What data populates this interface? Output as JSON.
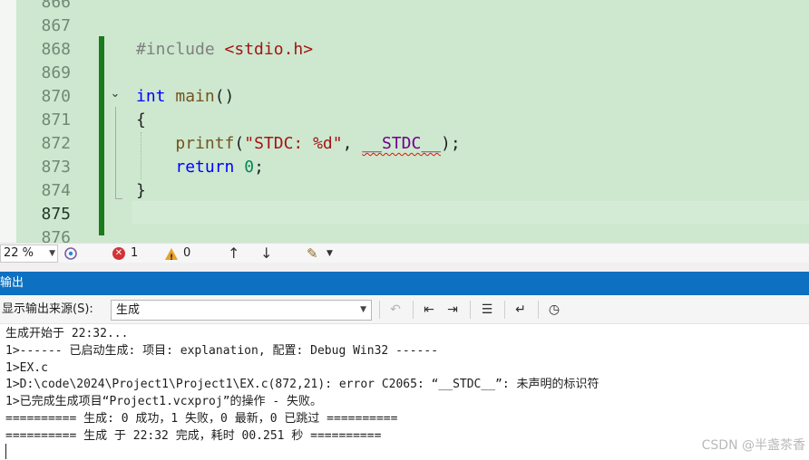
{
  "editor": {
    "lines": [
      {
        "num": "866",
        "tokens": []
      },
      {
        "num": "867",
        "tokens": []
      },
      {
        "num": "868",
        "tokens": [
          {
            "t": "#include ",
            "c": "pre"
          },
          {
            "t": "<stdio.h>",
            "c": "inc"
          }
        ]
      },
      {
        "num": "869",
        "tokens": []
      },
      {
        "num": "870",
        "tokens": [
          {
            "t": "int",
            "c": "kw"
          },
          {
            "t": " ",
            "c": "punc"
          },
          {
            "t": "main",
            "c": "fn"
          },
          {
            "t": "()",
            "c": "punc"
          }
        ]
      },
      {
        "num": "871",
        "tokens": [
          {
            "t": "{",
            "c": "punc"
          }
        ]
      },
      {
        "num": "872",
        "tokens": [
          {
            "t": "    ",
            "c": "punc"
          },
          {
            "t": "printf",
            "c": "fn"
          },
          {
            "t": "(",
            "c": "punc"
          },
          {
            "t": "\"STDC: %d\"",
            "c": "str"
          },
          {
            "t": ", ",
            "c": "punc"
          },
          {
            "t": "__STDC__",
            "c": "mac"
          },
          {
            "t": ");",
            "c": "punc"
          }
        ]
      },
      {
        "num": "873",
        "tokens": [
          {
            "t": "    ",
            "c": "punc"
          },
          {
            "t": "return",
            "c": "kw"
          },
          {
            "t": " ",
            "c": "punc"
          },
          {
            "t": "0",
            "c": "num"
          },
          {
            "t": ";",
            "c": "punc"
          }
        ]
      },
      {
        "num": "874",
        "tokens": [
          {
            "t": "}",
            "c": "punc"
          }
        ]
      },
      {
        "num": "875",
        "tokens": []
      },
      {
        "num": "876",
        "tokens": []
      }
    ]
  },
  "status_bar": {
    "zoom": "22 %",
    "errors": "1",
    "warnings": "0"
  },
  "output": {
    "title": "输出",
    "source_label": "显示输出来源(S):",
    "source_value": "生成",
    "lines": [
      "生成开始于 22:32...",
      "1>------ 已启动生成: 项目: explanation, 配置: Debug Win32 ------",
      "1>EX.c",
      "1>D:\\code\\2024\\Project1\\Project1\\EX.c(872,21): error C2065: “__STDC__”: 未声明的标识符",
      "1>已完成生成项目“Project1.vcxproj”的操作 - 失败。",
      "========== 生成: 0 成功，1 失败，0 最新，0 已跳过 ==========",
      "========== 生成 于 22:32 完成，耗时 00.251 秒 =========="
    ]
  },
  "watermark": "CSDN @半盏茶香"
}
